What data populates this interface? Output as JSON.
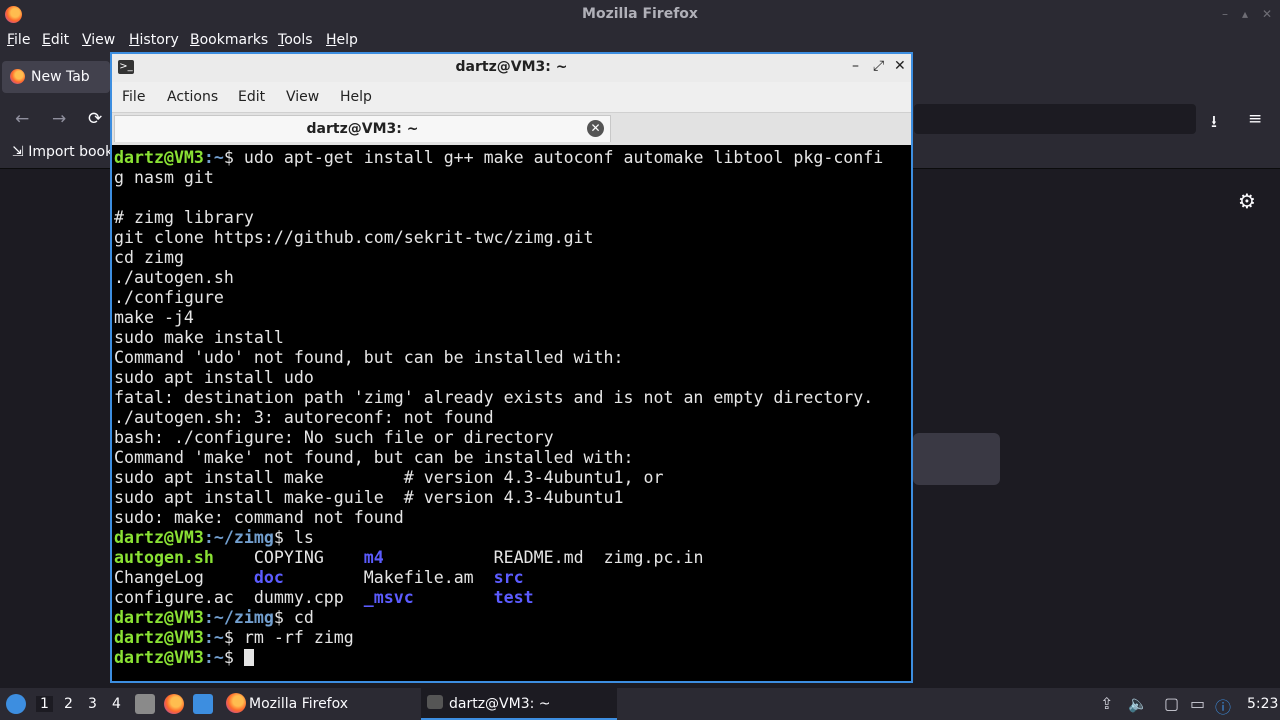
{
  "firefox": {
    "title": "Mozilla Firefox",
    "window_controls": [
      "–",
      "▴",
      "✕"
    ],
    "menu": [
      "File",
      "Edit",
      "View",
      "History",
      "Bookmarks",
      "Tools",
      "Help"
    ],
    "tab_label": "New Tab",
    "bookmarks_item": "Import book",
    "nav_icons": {
      "back": "←",
      "forward": "→",
      "reload": "⟳",
      "download": "⭳",
      "menu": "≡",
      "gear": "⚙"
    }
  },
  "terminal": {
    "title": "dartz@VM3: ~",
    "menu": [
      "File",
      "Actions",
      "Edit",
      "View",
      "Help"
    ],
    "tab_label": "dartz@VM3: ~",
    "tab_close": "✕",
    "controls": [
      "–",
      "⤢",
      "✕"
    ],
    "lines": [
      {
        "prompt_user": "dartz@VM3",
        "prompt_path": ":~",
        "prompt_sym": "$ ",
        "cmd": "udo apt-get install g++ make autoconf automake libtool pkg-confi"
      },
      {
        "text": "g nasm git"
      },
      {
        "text": ""
      },
      {
        "text": "# zimg library"
      },
      {
        "text": "git clone https://github.com/sekrit-twc/zimg.git"
      },
      {
        "text": "cd zimg"
      },
      {
        "text": "./autogen.sh"
      },
      {
        "text": "./configure"
      },
      {
        "text": "make -j4"
      },
      {
        "text": "sudo make install"
      },
      {
        "text": "Command 'udo' not found, but can be installed with:"
      },
      {
        "text": "sudo apt install udo"
      },
      {
        "text": "fatal: destination path 'zimg' already exists and is not an empty directory."
      },
      {
        "text": "./autogen.sh: 3: autoreconf: not found"
      },
      {
        "text": "bash: ./configure: No such file or directory"
      },
      {
        "text": "Command 'make' not found, but can be installed with:"
      },
      {
        "text": "sudo apt install make        # version 4.3-4ubuntu1, or"
      },
      {
        "text": "sudo apt install make-guile  # version 4.3-4ubuntu1"
      },
      {
        "text": "sudo: make: command not found"
      },
      {
        "prompt_user": "dartz@VM3",
        "prompt_path": ":~/zimg",
        "prompt_sym": "$ ",
        "cmd": "ls"
      },
      {
        "ls": [
          {
            "t": "autogen.sh    ",
            "k": "exe"
          },
          {
            "t": "COPYING    ",
            "k": "plain"
          },
          {
            "t": "m4           ",
            "k": "dir"
          },
          {
            "t": "README.md  ",
            "k": "plain"
          },
          {
            "t": "zimg.pc.in",
            "k": "plain"
          }
        ]
      },
      {
        "ls": [
          {
            "t": "ChangeLog     ",
            "k": "plain"
          },
          {
            "t": "doc        ",
            "k": "dir"
          },
          {
            "t": "Makefile.am  ",
            "k": "plain"
          },
          {
            "t": "src",
            "k": "dir"
          }
        ]
      },
      {
        "ls": [
          {
            "t": "configure.ac  ",
            "k": "plain"
          },
          {
            "t": "dummy.cpp  ",
            "k": "plain"
          },
          {
            "t": "_msvc        ",
            "k": "dir"
          },
          {
            "t": "test",
            "k": "dir"
          }
        ]
      },
      {
        "prompt_user": "dartz@VM3",
        "prompt_path": ":~/zimg",
        "prompt_sym": "$ ",
        "cmd": "cd"
      },
      {
        "prompt_user": "dartz@VM3",
        "prompt_path": ":~",
        "prompt_sym": "$ ",
        "cmd": "rm -rf zimg"
      },
      {
        "prompt_user": "dartz@VM3",
        "prompt_path": ":~",
        "prompt_sym": "$ ",
        "cmd": "",
        "cursor": true
      }
    ]
  },
  "taskbar": {
    "workspaces": [
      "1",
      "2",
      "3",
      "4"
    ],
    "active_workspace": "1",
    "windows": [
      "Mozilla Firefox",
      "dartz@VM3: ~"
    ],
    "clock": "5:23"
  }
}
